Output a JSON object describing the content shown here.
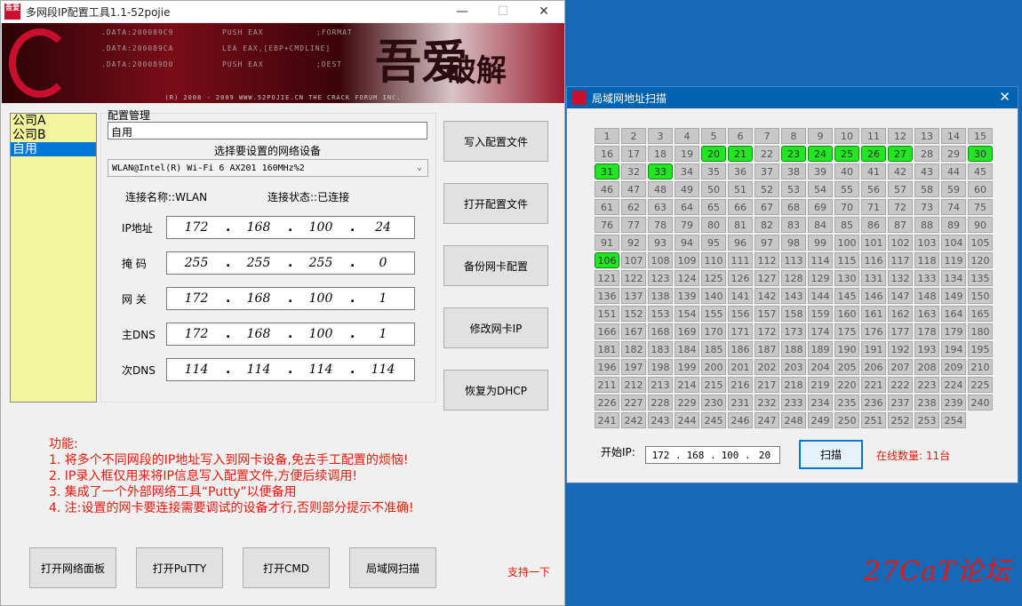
{
  "main": {
    "title": "多网段IP配置工具1.1-52pojie",
    "window_controls": {
      "minimize": "—",
      "maximize": "☐",
      "close": "✕"
    },
    "banner": {
      "lines": [
        [
          ".DATA:200089C9",
          "PUSH EAX",
          ";FORMAT"
        ],
        [
          ".DATA:200089CA",
          "LEA   EAX,[EBP+CMDLINE]",
          ""
        ],
        [
          ".DATA:200089D0",
          "PUSH EAX",
          ";DEST"
        ]
      ],
      "logo_text": "吾爱",
      "logo_text2": "破解",
      "footer": "(R) 2008 - 2009 WWW.52POJIE.CN  THE CRACK FORUM INC."
    },
    "profiles": [
      "公司A",
      "公司B",
      "自用"
    ],
    "profile_selected_index": 2,
    "config_manage_label": "配置管理",
    "config_name_value": "自用",
    "device_select_label": "选择要设置的网络设备",
    "device_value": "WLAN@Intel(R) Wi-Fi 6 AX201 160MHz%2",
    "connection_name": "连接名称::WLAN",
    "connection_status": "连接状态::已连接",
    "ip_fields": [
      {
        "label": "IP地址",
        "octets": [
          "172",
          "168",
          "100",
          "24"
        ]
      },
      {
        "label": "掩  码",
        "octets": [
          "255",
          "255",
          "255",
          "0"
        ]
      },
      {
        "label": "网  关",
        "octets": [
          "172",
          "168",
          "100",
          "1"
        ]
      },
      {
        "label": "主DNS",
        "octets": [
          "172",
          "168",
          "100",
          "1"
        ]
      },
      {
        "label": "次DNS",
        "octets": [
          "114",
          "114",
          "114",
          "114"
        ]
      }
    ],
    "right_buttons": [
      "写入配置文件",
      "打开配置文件",
      "备份网卡配置",
      "修改网卡IP",
      "恢复为DHCP"
    ],
    "features_title": "功能:",
    "features": [
      "1. 将多个不同网段的IP地址写入到网卡设备,免去手工配置的烦恼!",
      "2. IP录入框仅用来将IP信息写入配置文件,方便后续调用!",
      "3. 集成了一个外部网络工具“Putty”以便备用",
      "4. 注:设置的网卡要连接需要调试的设备才行,否则部分提示不准确!"
    ],
    "bottom_buttons": [
      "打开网络面板",
      "打开PuTTY",
      "打开CMD",
      "局域网扫描"
    ],
    "support_text": "支持一下"
  },
  "scan": {
    "title": "局域网地址扫描",
    "close": "✕",
    "cell_count": 254,
    "online_hosts": [
      20,
      21,
      23,
      24,
      25,
      26,
      27,
      30,
      31,
      33,
      106
    ],
    "start_ip_label": "开始IP:",
    "start_ip": [
      "172",
      "168",
      "100",
      "20"
    ],
    "scan_button": "扫描",
    "online_count": "在线数量: 11台",
    "colors": {
      "online": "#22e622",
      "offline": "#c8c8c8"
    }
  },
  "watermark": "27CaT论坛"
}
